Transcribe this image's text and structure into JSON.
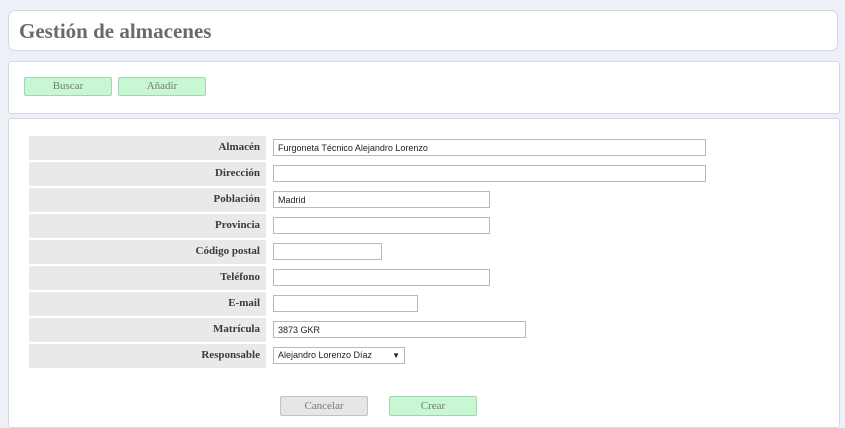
{
  "header": {
    "title": "Gestión de almacenes"
  },
  "toolbar": {
    "buscar_label": "Buscar",
    "anadir_label": "Añadir"
  },
  "form": {
    "fields": {
      "almacen": {
        "label": "Almacén",
        "value": "Furgoneta Técnico Alejandro Lorenzo"
      },
      "direccion": {
        "label": "Dirección",
        "value": ""
      },
      "poblacion": {
        "label": "Población",
        "value": "Madrid"
      },
      "provincia": {
        "label": "Provincia",
        "value": ""
      },
      "codigo_postal": {
        "label": "Código postal",
        "value": ""
      },
      "telefono": {
        "label": "Teléfono",
        "value": ""
      },
      "email": {
        "label": "E-mail",
        "value": ""
      },
      "matricula": {
        "label": "Matrícula",
        "value": "3873 GKR"
      },
      "responsable": {
        "label": "Responsable",
        "value": "Alejandro Lorenzo Díaz"
      }
    },
    "cancel_label": "Cancelar",
    "create_label": "Crear"
  },
  "colors": {
    "page_background": "#eef0f7",
    "green_button": "#c8f7d4",
    "gray_button": "#e6e6e6",
    "label_cell": "#e9e9e9"
  },
  "icons": {
    "select_arrow": "triangle-down-icon"
  }
}
